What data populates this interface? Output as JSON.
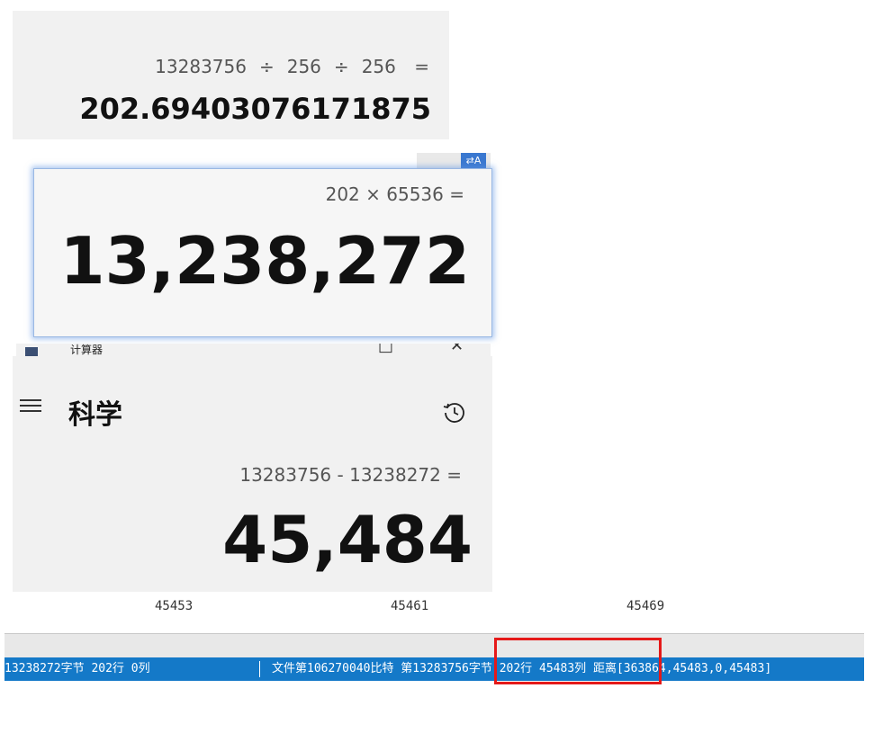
{
  "panel1": {
    "operand1": "13283756",
    "op1": "÷",
    "operand2": "256",
    "op2": "÷",
    "operand3": "256",
    "equals": "=",
    "result": "202.69403076171875"
  },
  "panel2": {
    "expression": "202 × 65536 =",
    "result": "13,238,272",
    "translate_icon_label": "⇄A"
  },
  "panel3": {
    "cut_title": "计算器",
    "mode_title": "科学",
    "expression": "13283756 - 13238272 =",
    "result": "45,484"
  },
  "ruler": {
    "labels": [
      "45453",
      "45461",
      "45469"
    ]
  },
  "statusbar": {
    "left_segment": "13238272字节 202行 0列",
    "right_segment": "文件第106270040比特 第13283756字节 202行 45483列 距离[363864,45483,0,45483]"
  },
  "colors": {
    "statusbar_bg": "#1479c8",
    "highlight_box": "#e51919",
    "panel2_glow": "#5f96e1"
  },
  "icons": {
    "menu": "hamburger-menu-icon",
    "history": "history-icon",
    "translate": "translate-icon",
    "calculator": "calculator-app-icon"
  }
}
